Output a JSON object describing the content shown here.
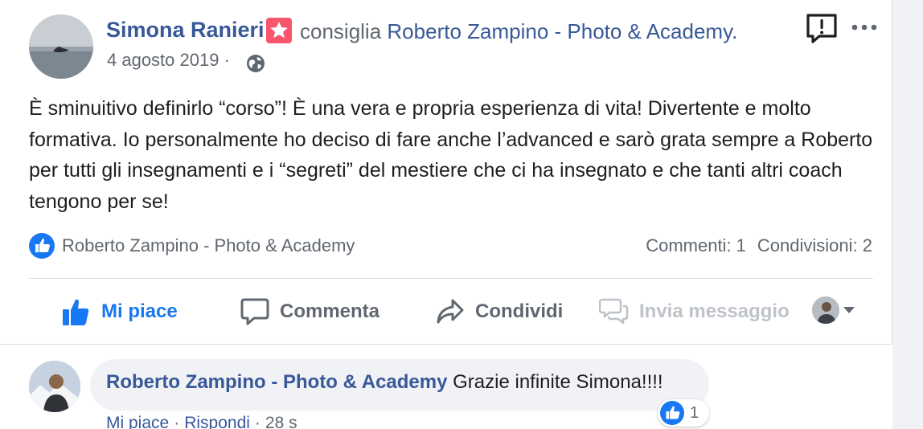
{
  "post": {
    "author": "Simona Ranieri",
    "recommends_text": "consiglia",
    "page_name": "Roberto Zampino - Photo & Academy",
    "page_suffix": ".",
    "date": "4 agosto 2019",
    "date_sep": "·",
    "body": "È sminuitivo definirlo “corso”! È una vera e propria esperienza di vita! Divertente e molto formativa. Io personalmente ho deciso di fare anche l’advanced e sarò grata sempre a Roberto per tutti gli insegnamenti e i “segreti” del mestiere che ci ha insegnato e che tanti altri coach tengono per se!",
    "icons": {
      "badge": "star-badge-icon",
      "privacy": "globe-icon",
      "report": "report-icon",
      "more": "more-icon"
    }
  },
  "summary": {
    "liker": "Roberto Zampino - Photo & Academy",
    "comments": "Commenti: 1",
    "shares": "Condivisioni: 2"
  },
  "actions": {
    "like": "Mi piace",
    "comment": "Commenta",
    "share": "Condividi",
    "message": "Invia messaggio"
  },
  "comment": {
    "author": "Roberto Zampino - Photo & Academy",
    "text": "Grazie infinite Simona!!!!",
    "reaction_count": "1",
    "like": "Mi piace",
    "reply": "Rispondi",
    "time": "28 s",
    "sep": "·"
  },
  "colors": {
    "link": "#385898",
    "accent": "#1877f2",
    "muted": "#606770",
    "badge": "#f7566d"
  }
}
